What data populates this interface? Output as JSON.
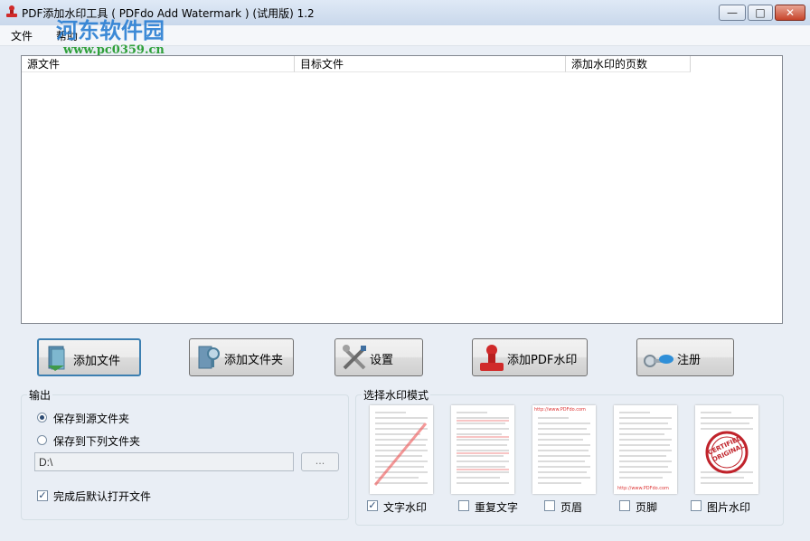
{
  "window": {
    "title": "PDF添加水印工具 ( PDFdo Add Watermark ) (试用版) 1.2",
    "min_icon": "—",
    "max_icon": "□",
    "close_icon": "✕"
  },
  "overlay": {
    "logo_text": "河东软件园",
    "url": "www.pc0359.cn"
  },
  "menu": [
    "文件",
    "帮助"
  ],
  "table": {
    "columns": [
      "源文件",
      "目标文件",
      "添加水印的页数"
    ],
    "rows": []
  },
  "toolbar": {
    "add_file": "添加文件",
    "add_folder": "添加文件夹",
    "settings": "设置",
    "add_watermark": "添加PDF水印",
    "register": "注册"
  },
  "output": {
    "title": "输出",
    "option_source": "保存到源文件夹",
    "option_target": "保存到下列文件夹",
    "selected": "source",
    "path": "D:\\",
    "browse": "...",
    "open_after": "完成后默认打开文件",
    "open_after_checked": true
  },
  "mode": {
    "title": "选择水印模式",
    "options": [
      {
        "label": "文字水印",
        "checked": true
      },
      {
        "label": "重复文字",
        "checked": false
      },
      {
        "label": "页眉",
        "checked": false
      },
      {
        "label": "页脚",
        "checked": false
      },
      {
        "label": "图片水印",
        "checked": false
      }
    ],
    "thumb_header_url": "http://www.PDFdo.com",
    "thumb_footer_url": "http://www.PDFdo.com",
    "stamp_text_1": "CERTIFIED",
    "stamp_text_2": "ORIGINAL"
  },
  "colors": {
    "accent": "#3c7fb1",
    "stamp_red": "#c0232b",
    "logo_blue": "#2a7fd3",
    "url_green": "#2fa03a"
  }
}
